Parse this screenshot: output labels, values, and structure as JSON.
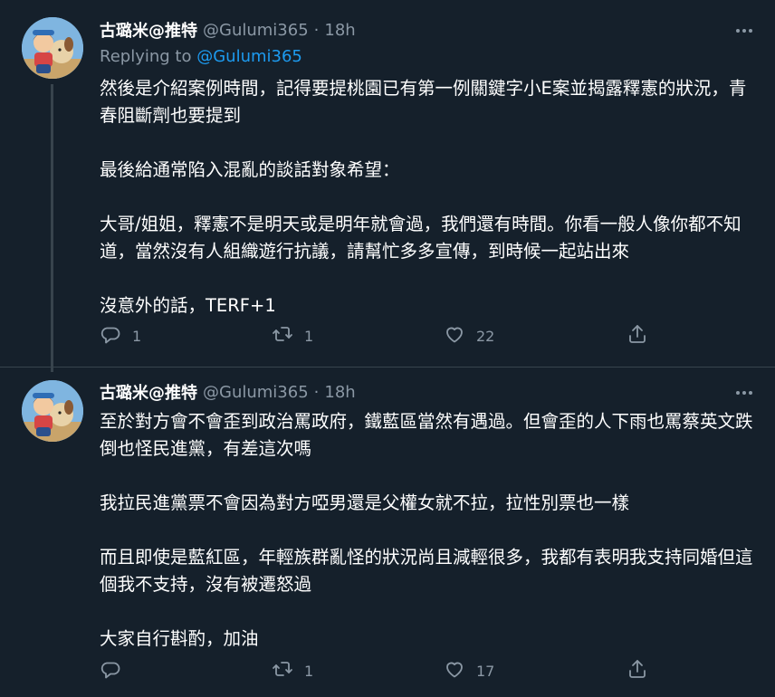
{
  "colors": {
    "background": "#15202b",
    "text": "#ffffff",
    "secondary_text": "#8b98a5",
    "link": "#1d9bf0",
    "divider": "#38444d"
  },
  "tweets": [
    {
      "author": {
        "name": "古璐米@推特",
        "handle": "@Gulumi365",
        "avatar_icon": "cartoon-girl-with-dog-avatar"
      },
      "separator": "·",
      "time": "18h",
      "replying_to": {
        "prefix": "Replying to",
        "mention": "@Gulumi365"
      },
      "paragraphs": [
        "然後是介紹案例時間，記得要提桃園已有第一例關鍵字小E案並揭露釋憲的狀況，青春阻斷劑也要提到",
        "最後給通常陷入混亂的談話對象希望：",
        "大哥/姐姐，釋憲不是明天或是明年就會過，我們還有時間。你看一般人像你都不知道，當然沒有人組織遊行抗議，請幫忙多多宣傳，到時候一起站出來",
        "沒意外的話，TERF+1"
      ],
      "actions": {
        "reply_count": "1",
        "retweet_count": "1",
        "like_count": "22"
      },
      "more_icon": "more-horizontal-icon"
    },
    {
      "author": {
        "name": "古璐米@推特",
        "handle": "@Gulumi365",
        "avatar_icon": "cartoon-girl-with-dog-avatar"
      },
      "separator": "·",
      "time": "18h",
      "paragraphs": [
        "至於對方會不會歪到政治罵政府，鐵藍區當然有遇過。但會歪的人下雨也罵蔡英文跌倒也怪民進黨，有差這次嗎",
        "我拉民進黨票不會因為對方啞男還是父權女就不拉，拉性別票也一樣",
        "而且即使是藍紅區，年輕族群亂怪的狀況尚且減輕很多，我都有表明我支持同婚但這個我不支持，沒有被遷怒過",
        "大家自行斟酌，加油"
      ],
      "actions": {
        "reply_count": "",
        "retweet_count": "1",
        "like_count": "17"
      },
      "more_icon": "more-horizontal-icon"
    }
  ]
}
